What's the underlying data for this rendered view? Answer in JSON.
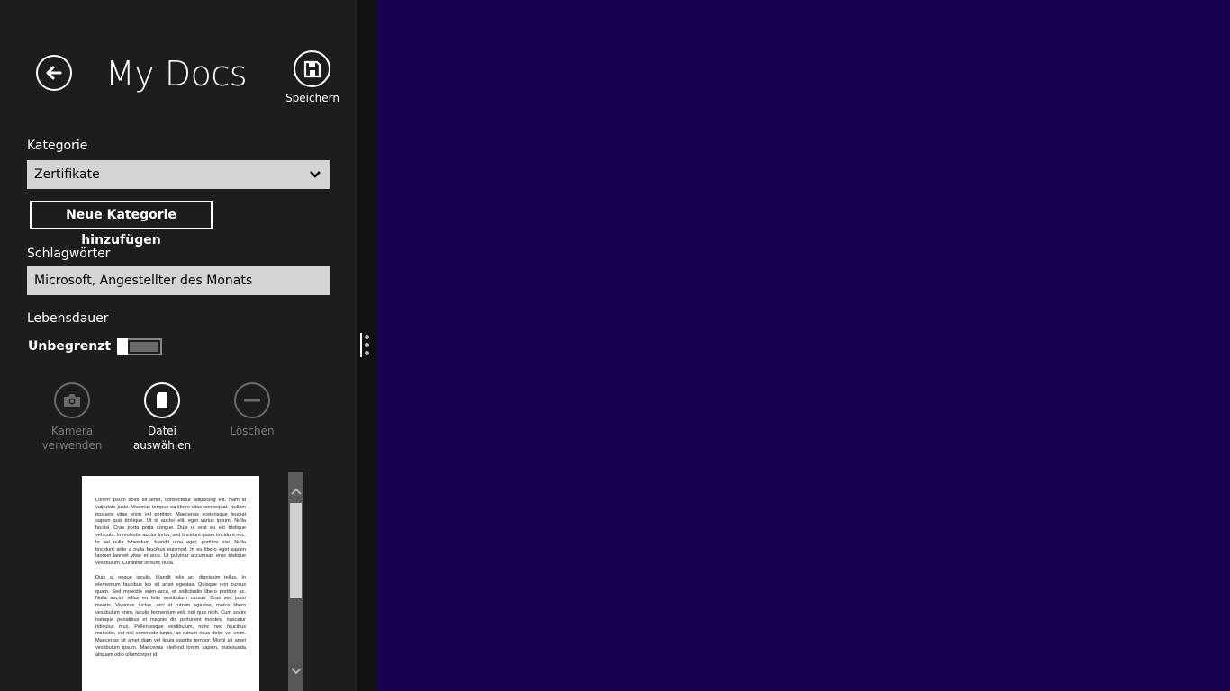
{
  "header": {
    "title": "My Docs",
    "save_label": "Speichern"
  },
  "form": {
    "category_label": "Kategorie",
    "category_value": "Zertifikate",
    "add_category_label": "Neue Kategorie hinzufügen",
    "tags_label": "Schlagwörter",
    "tags_value": "Microsoft, Angestellter des Monats",
    "lifetime_label": "Lebensdauer",
    "lifetime_value_label": "Unbegrenzt",
    "lifetime_toggle_on": false
  },
  "actions": {
    "camera_label_line1": "Kamera",
    "camera_label_line2": "verwenden",
    "choose_file_label": "Datei auswählen",
    "delete_label": "Löschen"
  },
  "preview": {
    "paragraph1": "Lorem ipsum dolor sit amet, consectetur adipiscing elit. Nam id vulputate justo. Vivamus tempus eu libero vitae consequat. Nullam posuere vitae enim vel porttitor. Maecenas scelerisque feugiat sapien quis tristique. Ut id auctor elit, eget varius ipsum. Nulla facilisi. Cras porta porta congue. Duis ut erat eu elit tristique vehicula. In molestie auctor tortor, sed tincidunt quam tincidunt nec. In vel nulla bibendum, blandit urna eget, porttitor nisi. Nulla tincidunt ante a nulla faucibus euismod. In eu libero eget sapien laoreet laoreet vitae et arcu. Ut pulvinar accumsan eros tristique vestibulum. Curabitur id nunc nulla.",
    "paragraph2": "Duis at neque iaculis, blandit felis ac, dignissim tellus. In elementum faucibus leo sit amet egestas. Quisque non cursus quam. Sed molestie enim arcu, et sollicitudin libero porttitor ac. Nulla auctor tellus eu felis vestibulum cursus. Cras sed justo mauris. Vivamus luctus, orci at rutrum egestas, metus libero vestibulum enim, iaculis fermentum velit nisi quis nibh. Cum sociis natoque penatibus et magnis dis parturient montes, nascetur ridiculus mus. Pellentesque vestibulum, nunc nec faucibus molestie, est nisl commodo turpis, ac rutrum risus dolor vel enim. Maecenas sit amet diam vel ligula sagittis tempor. Morbi sit amet vestibulum ipsum. Maecenas eleifend lorem sapien, malesuada aliquam odio ullamcorper id."
  },
  "colors": {
    "panel_bg": "#1d1d1d",
    "workspace_bg": "#180050",
    "field_bg": "#d4d4d4"
  }
}
